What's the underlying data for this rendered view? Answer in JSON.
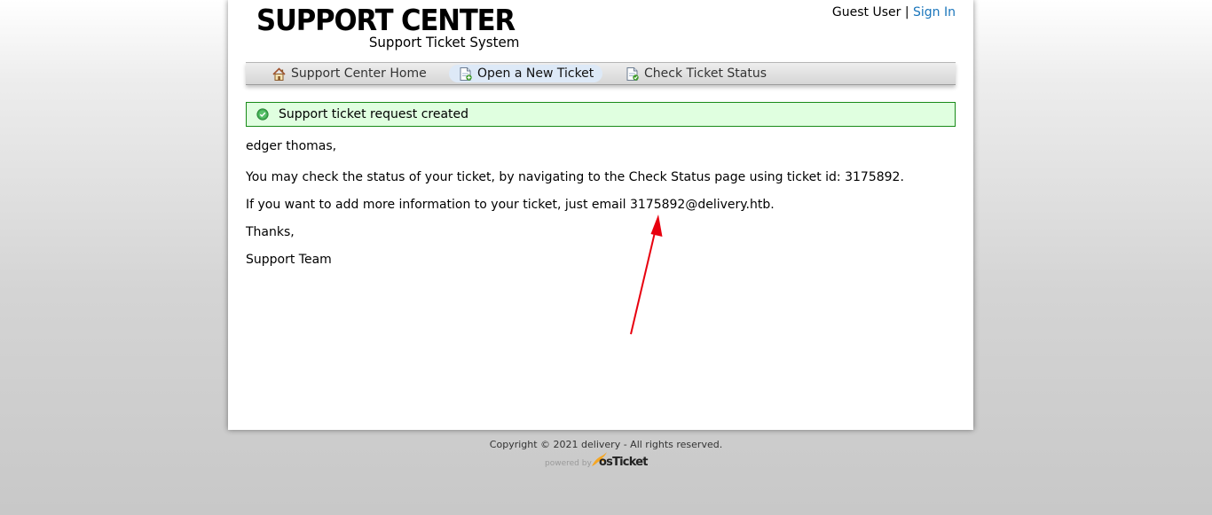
{
  "header": {
    "logo_title": "SUPPORT CENTER",
    "logo_subtitle": "Support Ticket System",
    "user_label": "Guest User",
    "separator": "|",
    "signin_label": "Sign In"
  },
  "nav": {
    "items": [
      {
        "label": "Support Center Home",
        "icon": "home-icon",
        "active": false
      },
      {
        "label": "Open a New Ticket",
        "icon": "new-ticket-icon",
        "active": true
      },
      {
        "label": "Check Ticket Status",
        "icon": "ticket-status-icon",
        "active": false
      }
    ]
  },
  "notice": {
    "icon": "check-circle-icon",
    "text": "Support ticket request created"
  },
  "message": {
    "greeting": "edger thomas,",
    "status_line": "You may check the status of your ticket, by navigating to the Check Status page using ticket id: 3175892.",
    "email_line": "If you want to add more information to your ticket, just email 3175892@delivery.htb.",
    "thanks": "Thanks,",
    "signature": "Support Team"
  },
  "annotation": {
    "icon": "red-arrow-annotation",
    "color": "#e8000f"
  },
  "footer": {
    "copyright": "Copyright © 2021 delivery - All rights reserved.",
    "powered_by": "powered by",
    "brand": "osTicket"
  },
  "colors": {
    "link": "#1a75bb",
    "notice_bg": "#e0ffe0",
    "notice_border": "#188a18",
    "active_tab_bg": "#dde9f7"
  }
}
